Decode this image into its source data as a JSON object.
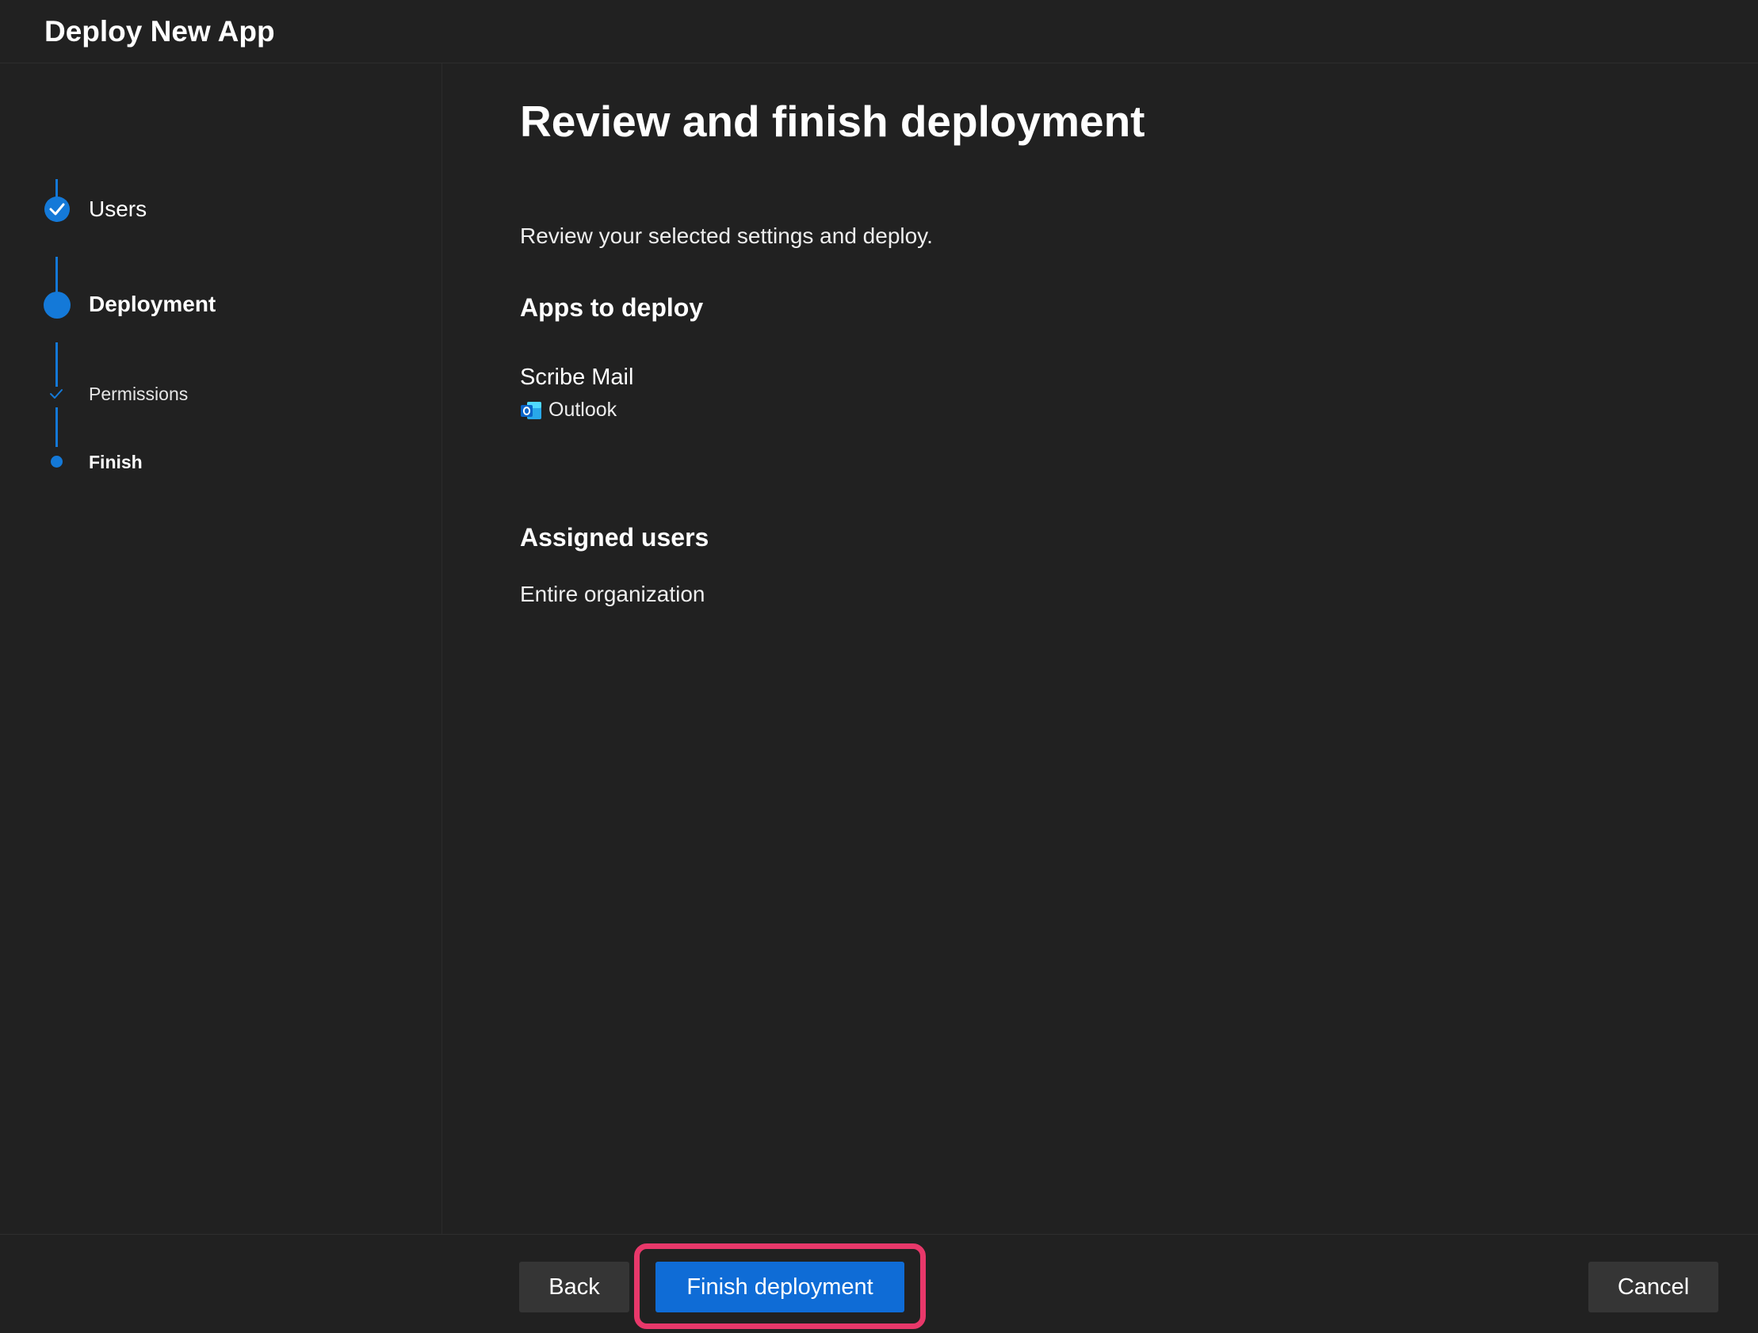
{
  "window": {
    "title": "Deploy New App"
  },
  "steps": [
    {
      "label": "Users",
      "state": "completed"
    },
    {
      "label": "Deployment",
      "state": "current"
    },
    {
      "label": "Permissions",
      "state": "completed-substep"
    },
    {
      "label": "Finish",
      "state": "current-substep"
    }
  ],
  "main": {
    "title": "Review and finish deployment",
    "description": "Review your selected settings and deploy.",
    "apps_heading": "Apps to deploy",
    "apps": [
      {
        "name": "Scribe Mail",
        "host": "Outlook",
        "icon": "outlook-icon"
      }
    ],
    "users_heading": "Assigned users",
    "users_value": "Entire organization"
  },
  "footer": {
    "back_label": "Back",
    "finish_label": "Finish deployment",
    "cancel_label": "Cancel"
  },
  "colors": {
    "background": "#212121",
    "accent": "#1479d8",
    "primary_button": "#0f6cd6",
    "secondary_button": "#353535",
    "highlight": "#e8386a"
  }
}
